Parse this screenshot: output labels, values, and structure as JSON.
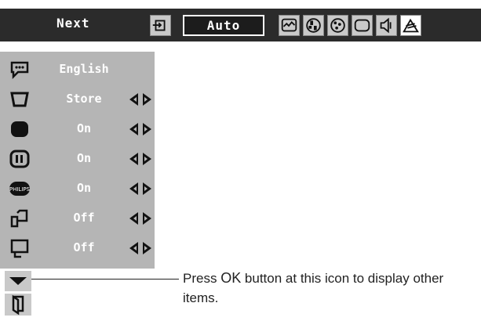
{
  "toolbar": {
    "next_label": "Next",
    "auto_label": "Auto",
    "icons": [
      "enter-icon",
      "screen-icon",
      "image-adjust-icon",
      "color-icon",
      "screen-size-icon",
      "sound-icon",
      "setting-icon"
    ]
  },
  "setting_menu": {
    "rows": [
      {
        "icon": "language-icon",
        "value": "English"
      },
      {
        "icon": "keystone-icon",
        "value": "Store"
      },
      {
        "icon": "blue-back-icon",
        "value": "On"
      },
      {
        "icon": "display-icon",
        "value": "On"
      },
      {
        "icon": "logo-icon",
        "value": "On"
      },
      {
        "icon": "ceiling-icon",
        "value": "Off"
      },
      {
        "icon": "rear-icon",
        "value": "Off"
      }
    ],
    "scroll_icon": "down-triangle-icon",
    "door_icon": "door-icon"
  },
  "callout": {
    "text_before": "Press ",
    "text_key": "OK",
    "text_after": " button at this icon to display other items."
  },
  "colors": {
    "toolbar_bg": "#2b2b2b",
    "panel_bg": "#b5b5b5",
    "text_light": "#ffffff"
  }
}
